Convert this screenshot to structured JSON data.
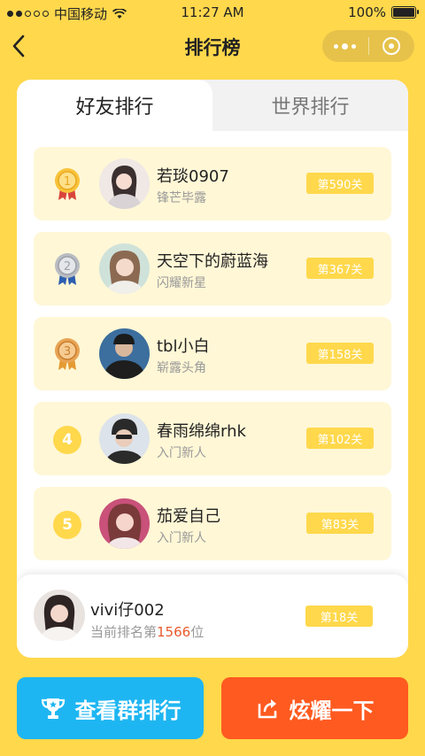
{
  "status": {
    "carrier": "中国移动",
    "time": "11:27 AM",
    "battery": "100%"
  },
  "nav": {
    "title": "排行榜"
  },
  "tabs": {
    "friends": "好友排行",
    "world": "世界排行"
  },
  "rows": [
    {
      "rank": "1",
      "name": "若琰0907",
      "subtitle": "锋芒毕露",
      "level": "第590关"
    },
    {
      "rank": "2",
      "name": "天空下的蔚蓝海",
      "subtitle": "闪耀新星",
      "level": "第367关"
    },
    {
      "rank": "3",
      "name": "tbl小白",
      "subtitle": "崭露头角",
      "level": "第158关"
    },
    {
      "rank": "4",
      "name": "春雨绵绵rhk",
      "subtitle": "入门新人",
      "level": "第102关"
    },
    {
      "rank": "5",
      "name": "茄爱自己",
      "subtitle": "入门新人",
      "level": "第83关"
    }
  ],
  "me": {
    "name": "vivi仔002",
    "rank_prefix": "当前排名第",
    "rank_value": "1566",
    "rank_suffix": "位",
    "level": "第18关"
  },
  "buttons": {
    "group": "查看群排行",
    "share": "炫耀一下"
  },
  "colors": {
    "background": "#FFD84C",
    "row": "#FFF7D6",
    "blue": "#1EB6F2",
    "orange": "#FF5A20",
    "highlight": "#E85A2D"
  }
}
